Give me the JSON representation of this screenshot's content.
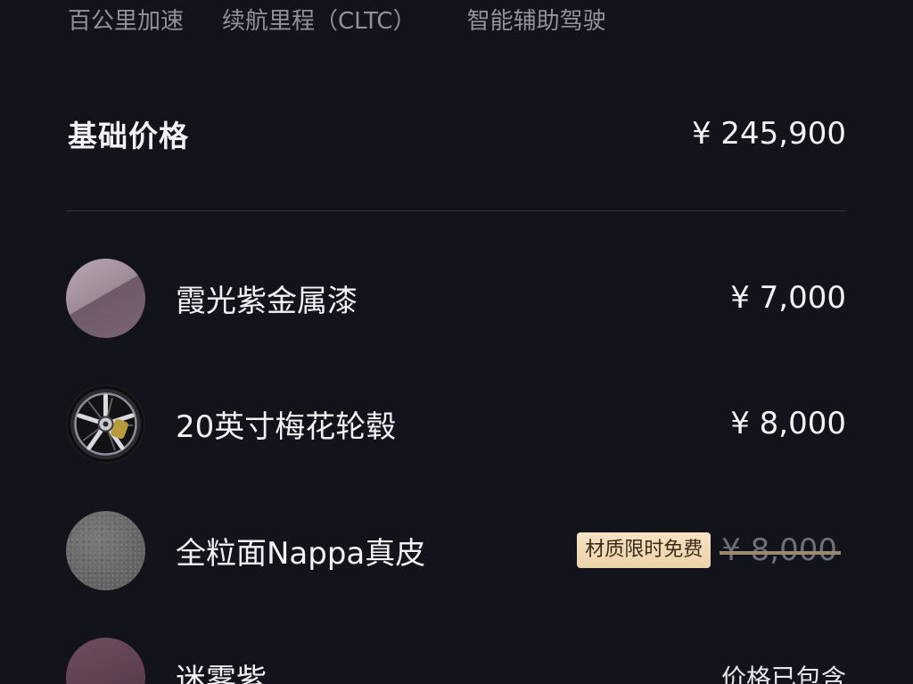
{
  "spec_tabs": [
    "百公里加速",
    "续航里程（CLTC）",
    "智能辅助驾驶"
  ],
  "base_price": {
    "label": "基础价格",
    "value": "¥ 245,900"
  },
  "options": [
    {
      "name": "霞光紫金属漆",
      "price": "¥ 7,000",
      "swatch": "purple-metallic-paint"
    },
    {
      "name": "20英寸梅花轮毂",
      "price": "¥ 8,000",
      "swatch": "plum-blossom-wheel"
    },
    {
      "name": "全粒面Nappa真皮",
      "badge": "材质限时免费",
      "price": "¥ 8,000",
      "price_struck": true,
      "swatch": "grey-leather"
    },
    {
      "name": "迷雾紫",
      "note": "价格已包含",
      "swatch": "mist-purple-interior"
    }
  ],
  "colors": {
    "background": "#13141b",
    "badge": "#f1dcb8",
    "muted_text": "#8f929b"
  }
}
